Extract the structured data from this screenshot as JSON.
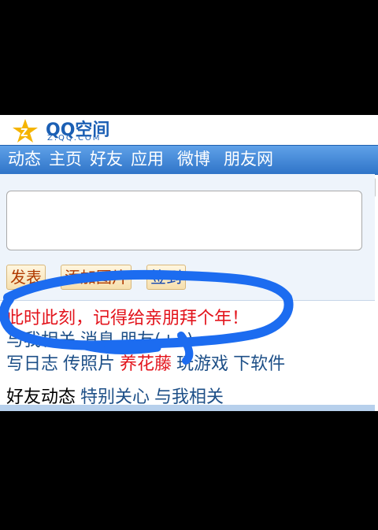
{
  "header": {
    "logo_text": "QQ空间",
    "logo_sub": "Z.QQ.COM"
  },
  "nav": [
    "动态",
    "主页",
    "好友",
    "应用",
    "微博",
    "朋友网"
  ],
  "compose": {
    "textarea_value": "",
    "publish_label": "发表",
    "add_photo_label": "添加图片",
    "sign_label": "签到"
  },
  "promo": "此时此刻，记得给亲朋拜个年！",
  "links_row1": [
    "与我相关",
    "消息",
    "朋友(+1)"
  ],
  "links_row2": [
    "写日志",
    "传照片",
    "养花藤",
    "玩游戏",
    "下软件"
  ],
  "feed_row": [
    "好友动态",
    "特别关心",
    "与我相关"
  ],
  "colors": {
    "nav_bg": "#2f74c8",
    "promo_red": "#e3141c",
    "link_blue": "#1d4f87",
    "scribble_blue": "#1c6cf0"
  }
}
